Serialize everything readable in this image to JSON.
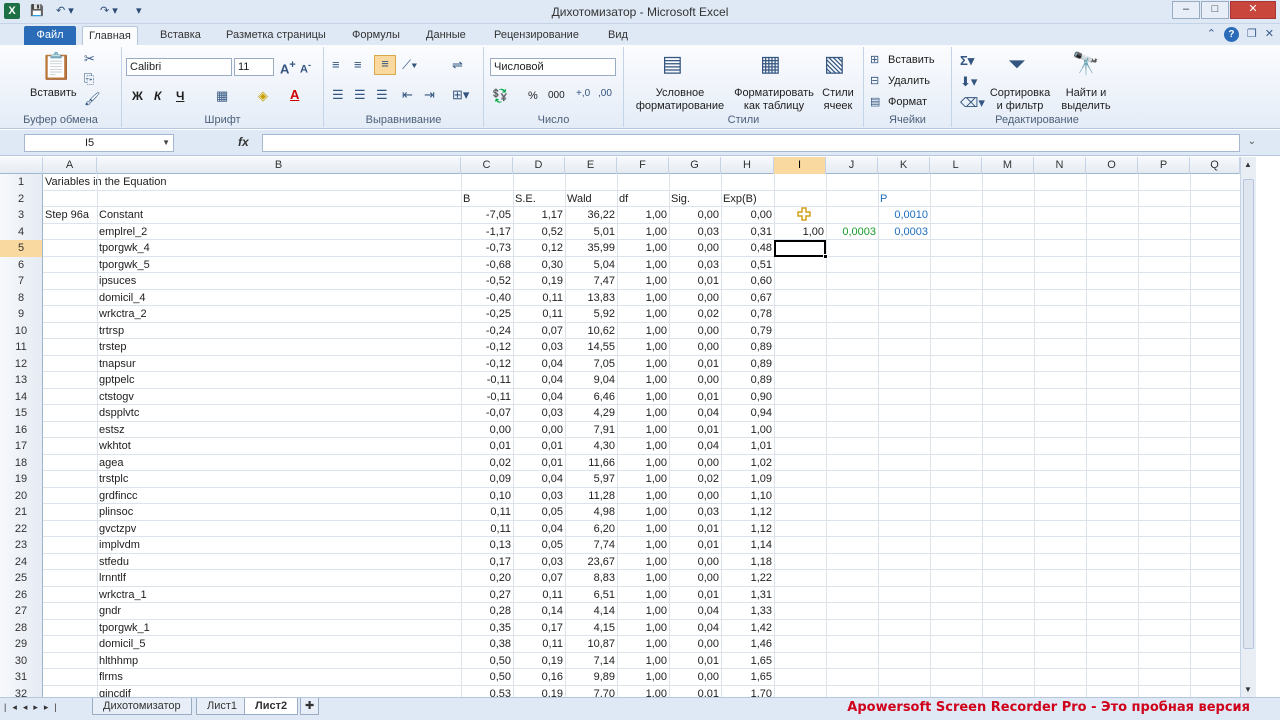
{
  "window": {
    "title": "Дихотомизатор  -  Microsoft Excel",
    "minimize": "–",
    "restore": "□",
    "close": "✕"
  },
  "tabs": {
    "file": "Файл",
    "items": [
      "Главная",
      "Вставка",
      "Разметка страницы",
      "Формулы",
      "Данные",
      "Рецензирование",
      "Вид"
    ]
  },
  "ribbon": {
    "clipboard": {
      "label": "Буфер обмена",
      "paste": "Вставить"
    },
    "font": {
      "label": "Шрифт",
      "name": "Calibri",
      "size": "11",
      "bold": "Ж",
      "italic": "К",
      "underline": "Ч"
    },
    "alignment": {
      "label": "Выравнивание"
    },
    "number": {
      "label": "Число",
      "format": "Числовой",
      "percent": "%",
      "thousands": "000"
    },
    "styles": {
      "label": "Стили",
      "conditional": "Условное форматирование",
      "as_table": "Форматировать как таблицу",
      "cell_styles": "Стили ячеек"
    },
    "cells": {
      "label": "Ячейки",
      "insert": "Вставить",
      "delete": "Удалить",
      "format": "Формат"
    },
    "editing": {
      "label": "Редактирование",
      "sort": "Сортировка и фильтр",
      "find": "Найти и выделить"
    }
  },
  "formula_bar": {
    "name_box": "I5",
    "fx": "fx",
    "value": ""
  },
  "columns": [
    "A",
    "B",
    "C",
    "D",
    "E",
    "F",
    "G",
    "H",
    "I",
    "J",
    "K",
    "L",
    "M",
    "N",
    "O",
    "P",
    "Q"
  ],
  "rows": [
    {
      "n": "1",
      "a": "Variables in the Equation",
      "b": "",
      "c": "",
      "d": "",
      "e": "",
      "f": "",
      "g": "",
      "h": ""
    },
    {
      "n": "2",
      "a": "",
      "b": "",
      "c": "B",
      "d": "S.E.",
      "e": "Wald",
      "f": "df",
      "g": "Sig.",
      "h": "Exp(B)",
      "k": "P"
    },
    {
      "n": "3",
      "a": "Step 96a",
      "b": "Constant",
      "c": "-7,05",
      "d": "1,17",
      "e": "36,22",
      "f": "1,00",
      "g": "0,00",
      "h": "0,00",
      "k": "0,0010"
    },
    {
      "n": "4",
      "a": "",
      "b": "emplrel_2",
      "c": "-1,17",
      "d": "0,52",
      "e": "5,01",
      "f": "1,00",
      "g": "0,03",
      "h": "0,31",
      "i": "1,00",
      "j": "0,0003",
      "k": "0,0003"
    },
    {
      "n": "5",
      "a": "",
      "b": "tporgwk_4",
      "c": "-0,73",
      "d": "0,12",
      "e": "35,99",
      "f": "1,00",
      "g": "0,00",
      "h": "0,48"
    },
    {
      "n": "6",
      "a": "",
      "b": "tporgwk_5",
      "c": "-0,68",
      "d": "0,30",
      "e": "5,04",
      "f": "1,00",
      "g": "0,03",
      "h": "0,51"
    },
    {
      "n": "7",
      "a": "",
      "b": "ipsuces",
      "c": "-0,52",
      "d": "0,19",
      "e": "7,47",
      "f": "1,00",
      "g": "0,01",
      "h": "0,60"
    },
    {
      "n": "8",
      "a": "",
      "b": "domicil_4",
      "c": "-0,40",
      "d": "0,11",
      "e": "13,83",
      "f": "1,00",
      "g": "0,00",
      "h": "0,67"
    },
    {
      "n": "9",
      "a": "",
      "b": "wrkctra_2",
      "c": "-0,25",
      "d": "0,11",
      "e": "5,92",
      "f": "1,00",
      "g": "0,02",
      "h": "0,78"
    },
    {
      "n": "10",
      "a": "",
      "b": "trtrsp",
      "c": "-0,24",
      "d": "0,07",
      "e": "10,62",
      "f": "1,00",
      "g": "0,00",
      "h": "0,79"
    },
    {
      "n": "11",
      "a": "",
      "b": "trstep",
      "c": "-0,12",
      "d": "0,03",
      "e": "14,55",
      "f": "1,00",
      "g": "0,00",
      "h": "0,89"
    },
    {
      "n": "12",
      "a": "",
      "b": "tnapsur",
      "c": "-0,12",
      "d": "0,04",
      "e": "7,05",
      "f": "1,00",
      "g": "0,01",
      "h": "0,89"
    },
    {
      "n": "13",
      "a": "",
      "b": "gptpelc",
      "c": "-0,11",
      "d": "0,04",
      "e": "9,04",
      "f": "1,00",
      "g": "0,00",
      "h": "0,89"
    },
    {
      "n": "14",
      "a": "",
      "b": "ctstogv",
      "c": "-0,11",
      "d": "0,04",
      "e": "6,46",
      "f": "1,00",
      "g": "0,01",
      "h": "0,90"
    },
    {
      "n": "15",
      "a": "",
      "b": "dspplvtc",
      "c": "-0,07",
      "d": "0,03",
      "e": "4,29",
      "f": "1,00",
      "g": "0,04",
      "h": "0,94"
    },
    {
      "n": "16",
      "a": "",
      "b": "estsz",
      "c": "0,00",
      "d": "0,00",
      "e": "7,91",
      "f": "1,00",
      "g": "0,01",
      "h": "1,00"
    },
    {
      "n": "17",
      "a": "",
      "b": "wkhtot",
      "c": "0,01",
      "d": "0,01",
      "e": "4,30",
      "f": "1,00",
      "g": "0,04",
      "h": "1,01"
    },
    {
      "n": "18",
      "a": "",
      "b": "agea",
      "c": "0,02",
      "d": "0,01",
      "e": "11,66",
      "f": "1,00",
      "g": "0,00",
      "h": "1,02"
    },
    {
      "n": "19",
      "a": "",
      "b": "trstplc",
      "c": "0,09",
      "d": "0,04",
      "e": "5,97",
      "f": "1,00",
      "g": "0,02",
      "h": "1,09"
    },
    {
      "n": "20",
      "a": "",
      "b": "grdfincc",
      "c": "0,10",
      "d": "0,03",
      "e": "11,28",
      "f": "1,00",
      "g": "0,00",
      "h": "1,10"
    },
    {
      "n": "21",
      "a": "",
      "b": "plinsoc",
      "c": "0,11",
      "d": "0,05",
      "e": "4,98",
      "f": "1,00",
      "g": "0,03",
      "h": "1,12"
    },
    {
      "n": "22",
      "a": "",
      "b": "gvctzpv",
      "c": "0,11",
      "d": "0,04",
      "e": "6,20",
      "f": "1,00",
      "g": "0,01",
      "h": "1,12"
    },
    {
      "n": "23",
      "a": "",
      "b": "implvdm",
      "c": "0,13",
      "d": "0,05",
      "e": "7,74",
      "f": "1,00",
      "g": "0,01",
      "h": "1,14"
    },
    {
      "n": "24",
      "a": "",
      "b": "stfedu",
      "c": "0,17",
      "d": "0,03",
      "e": "23,67",
      "f": "1,00",
      "g": "0,00",
      "h": "1,18"
    },
    {
      "n": "25",
      "a": "",
      "b": "lrnntlf",
      "c": "0,20",
      "d": "0,07",
      "e": "8,83",
      "f": "1,00",
      "g": "0,00",
      "h": "1,22"
    },
    {
      "n": "26",
      "a": "",
      "b": "wrkctra_1",
      "c": "0,27",
      "d": "0,11",
      "e": "6,51",
      "f": "1,00",
      "g": "0,01",
      "h": "1,31"
    },
    {
      "n": "27",
      "a": "",
      "b": "gndr",
      "c": "0,28",
      "d": "0,14",
      "e": "4,14",
      "f": "1,00",
      "g": "0,04",
      "h": "1,33"
    },
    {
      "n": "28",
      "a": "",
      "b": "tporgwk_1",
      "c": "0,35",
      "d": "0,17",
      "e": "4,15",
      "f": "1,00",
      "g": "0,04",
      "h": "1,42"
    },
    {
      "n": "29",
      "a": "",
      "b": "domicil_5",
      "c": "0,38",
      "d": "0,11",
      "e": "10,87",
      "f": "1,00",
      "g": "0,00",
      "h": "1,46"
    },
    {
      "n": "30",
      "a": "",
      "b": "hlthhmp",
      "c": "0,50",
      "d": "0,19",
      "e": "7,14",
      "f": "1,00",
      "g": "0,01",
      "h": "1,65"
    },
    {
      "n": "31",
      "a": "",
      "b": "flrms",
      "c": "0,50",
      "d": "0,16",
      "e": "9,89",
      "f": "1,00",
      "g": "0,00",
      "h": "1,65"
    },
    {
      "n": "32",
      "a": "",
      "b": "gincdif",
      "c": "0,53",
      "d": "0,19",
      "e": "7,70",
      "f": "1,00",
      "g": "0,01",
      "h": "1,70"
    }
  ],
  "sheets": [
    "Дихотомизатор",
    "Лист1",
    "Лист2"
  ],
  "active_sheet": "Лист2",
  "watermark": "Apowersoft Screen Recorder Pro - Это пробная версия",
  "colors": {
    "green_text": "#1a9a2a",
    "blue_text": "#1f6fbf",
    "selection": "#f9d99f"
  }
}
